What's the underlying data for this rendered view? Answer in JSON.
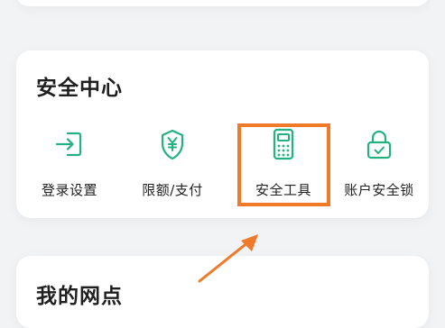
{
  "security_center": {
    "title": "安全中心",
    "items": [
      {
        "label": "登录设置",
        "icon": "login-arrow-icon"
      },
      {
        "label": "限额/支付",
        "icon": "shield-yuan-icon"
      },
      {
        "label": "安全工具",
        "icon": "security-token-icon"
      },
      {
        "label": "账户安全锁",
        "icon": "lock-icon"
      }
    ]
  },
  "my_branch": {
    "title": "我的网点"
  },
  "annotation": {
    "highlighted_item": "安全工具",
    "highlight_color": "#f07a2a"
  },
  "colors": {
    "accent": "#23b27f",
    "background": "#f2f3f5",
    "card": "#ffffff"
  }
}
